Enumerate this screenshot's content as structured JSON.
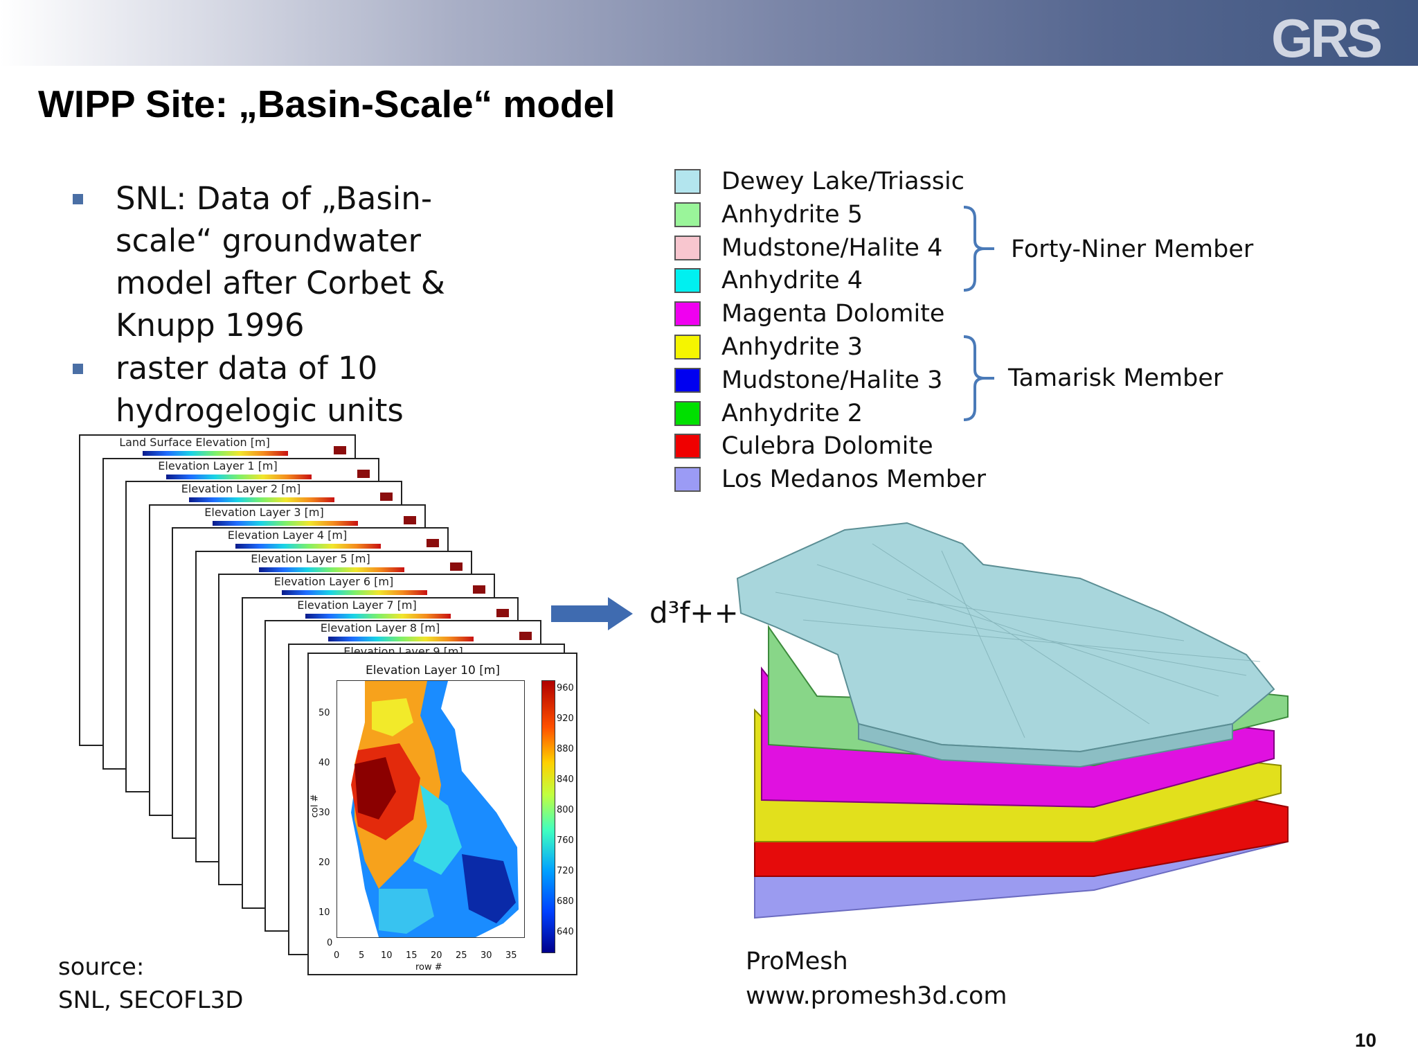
{
  "header": {
    "logo_text": "GRS",
    "title": "WIPP Site: „Basin-Scale“ model",
    "page_number": "10"
  },
  "bullets": [
    "SNL: Data of „Basin-scale“ groundwater model after Corbet & Knupp 1996",
    "raster data of 10 hydrogelogic units"
  ],
  "legend": {
    "items": [
      {
        "label": "Dewey Lake/Triassic",
        "color": "#b3e5ee"
      },
      {
        "label": "Anhydrite 5",
        "color": "#9af59a"
      },
      {
        "label": "Mudstone/Halite 4",
        "color": "#f8c6cf"
      },
      {
        "label": "Anhydrite 4",
        "color": "#00f0f0"
      },
      {
        "label": "Magenta Dolomite",
        "color": "#f000f0"
      },
      {
        "label": "Anhydrite 3",
        "color": "#f5f500"
      },
      {
        "label": "Mudstone/Halite 3",
        "color": "#0000f0"
      },
      {
        "label": "Anhydrite 2",
        "color": "#00e000"
      },
      {
        "label": "Culebra Dolomite",
        "color": "#f00000"
      },
      {
        "label": "Los Medanos Member",
        "color": "#9b9bf5"
      }
    ],
    "groups": [
      {
        "label": "Forty-Niner Member"
      },
      {
        "label": "Tamarisk Member"
      }
    ]
  },
  "raster_stack": {
    "layer_titles": [
      "Land Surface Elevation [m]",
      "Elevation Layer 1 [m]",
      "Elevation Layer 2 [m]",
      "Elevation Layer 3 [m]",
      "Elevation Layer 4 [m]",
      "Elevation Layer 5 [m]",
      "Elevation Layer 6 [m]",
      "Elevation Layer 7 [m]",
      "Elevation Layer 8 [m]",
      "Elevation Layer 9 [m]"
    ],
    "front": {
      "title": "Elevation Layer 10 [m]",
      "y_axis_label": "col #",
      "x_axis_label": "row #",
      "y_ticks": [
        "50",
        "40",
        "30",
        "20",
        "10",
        "0"
      ],
      "x_ticks": [
        "0",
        "5",
        "10",
        "15",
        "20",
        "25",
        "30",
        "35"
      ],
      "colorbar_ticks": [
        "960",
        "920",
        "880",
        "840",
        "800",
        "760",
        "720",
        "680",
        "640"
      ]
    }
  },
  "flow": {
    "target_label": "d³f++"
  },
  "sources": {
    "left_line1": "source:",
    "left_line2": "SNL, SECOFL3D",
    "right_line1": "ProMesh",
    "right_line2": "www.promesh3d.com"
  }
}
